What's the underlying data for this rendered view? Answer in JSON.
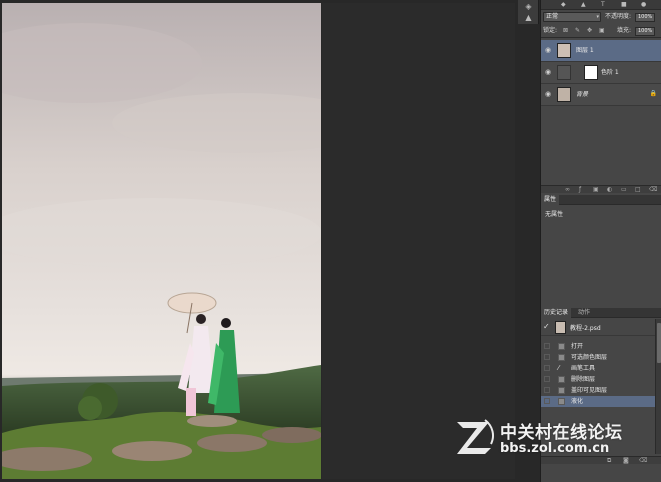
{
  "layers_panel": {
    "blend_mode": "正常",
    "opacity_label": "不透明度:",
    "opacity_value": "100%",
    "lock_label": "锁定:",
    "fill_label": "填充:",
    "fill_value": "100%",
    "layers": [
      {
        "name": "图层 1",
        "selected": true,
        "italic": false
      },
      {
        "name": "色阶 1",
        "selected": false,
        "italic": false
      },
      {
        "name": "背景",
        "selected": false,
        "italic": true
      }
    ],
    "lock_icon": "lock-icon"
  },
  "properties_panel": {
    "tab_label": "属性",
    "content": "无属性"
  },
  "history_panel": {
    "tabs": [
      "历史记录",
      "动作"
    ],
    "snapshot": "教程-2.psd",
    "steps": [
      {
        "name": "打开",
        "selected": false
      },
      {
        "name": "可选颜色图层",
        "selected": false
      },
      {
        "name": "画笔工具",
        "selected": false
      },
      {
        "name": "删除图层",
        "selected": false
      },
      {
        "name": "盖印可见图层",
        "selected": false
      },
      {
        "name": "液化",
        "selected": true
      }
    ]
  },
  "watermark": {
    "title": "中关村在线论坛",
    "url": "bbs.zol.com.cn",
    "logo_letter": "Z"
  },
  "colors": {
    "panel_bg": "#464646",
    "selection": "#5b6b86",
    "workspace": "#282828"
  }
}
